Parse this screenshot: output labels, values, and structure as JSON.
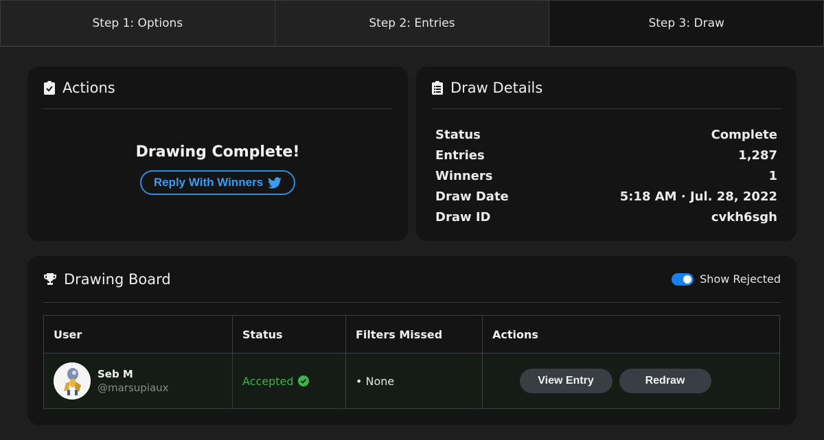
{
  "tabs": [
    {
      "label": "Step 1: Options"
    },
    {
      "label": "Step 2: Entries"
    },
    {
      "label": "Step 3: Draw"
    }
  ],
  "actions": {
    "title": "Actions",
    "complete_text": "Drawing Complete!",
    "reply_button": "Reply With Winners"
  },
  "details": {
    "title": "Draw Details",
    "rows": [
      {
        "label": "Status",
        "value": "Complete"
      },
      {
        "label": "Entries",
        "value": "1,287"
      },
      {
        "label": "Winners",
        "value": "1"
      },
      {
        "label": "Draw Date",
        "value": "5:18 AM · Jul. 28, 2022"
      },
      {
        "label": "Draw ID",
        "value": "cvkh6sgh"
      }
    ]
  },
  "board": {
    "title": "Drawing Board",
    "toggle_label": "Show Rejected",
    "toggle_on": true,
    "columns": [
      "User",
      "Status",
      "Filters Missed",
      "Actions"
    ],
    "rows": [
      {
        "name": "Seb M",
        "handle": "@marsupiaux",
        "status": "Accepted",
        "filters_missed": "• None",
        "view_button": "View Entry",
        "redraw_button": "Redraw"
      }
    ]
  },
  "colors": {
    "accent": "#1a7ff0",
    "twitter": "#3a9bf0",
    "accepted": "#3ab54a"
  }
}
